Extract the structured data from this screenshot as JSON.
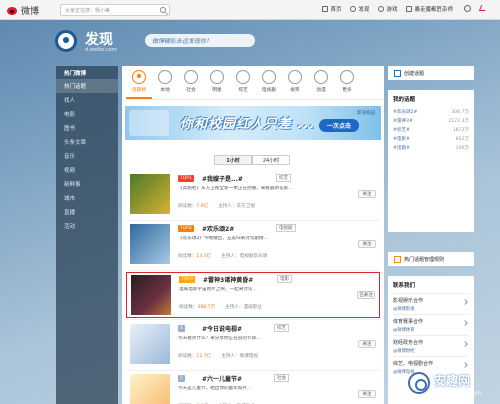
{
  "topbar": {
    "logo_text": "微博",
    "search_placeholder": "大家正在搜：杨小美",
    "nav": [
      "首页",
      "发现",
      "游戏",
      "暴走魔都匠杂师"
    ]
  },
  "header": {
    "title": "发现",
    "domain": "d.weibo.com",
    "slogan": "微博精彩永远发现你！"
  },
  "left_nav": {
    "items": [
      {
        "label": "热门微博",
        "head": true,
        "active": false
      },
      {
        "label": "热门话题",
        "head": false,
        "active": true
      },
      {
        "label": "找人",
        "head": false,
        "active": false
      },
      {
        "label": "电影",
        "head": false,
        "active": false
      },
      {
        "label": "图书",
        "head": false,
        "active": false
      },
      {
        "label": "头条文章",
        "head": false,
        "active": false
      },
      {
        "label": "音乐",
        "head": false,
        "active": false
      },
      {
        "label": "视频",
        "head": false,
        "active": false
      },
      {
        "label": "新鲜事",
        "head": false,
        "active": false
      },
      {
        "label": "城市",
        "head": false,
        "active": false
      },
      {
        "label": "直播",
        "head": false,
        "active": false
      },
      {
        "label": "活动",
        "head": false,
        "active": false
      }
    ]
  },
  "categories": [
    {
      "label": "话题榜",
      "active": true
    },
    {
      "label": "本地",
      "active": false
    },
    {
      "label": "社会",
      "active": false
    },
    {
      "label": "明星",
      "active": false
    },
    {
      "label": "综艺",
      "active": false
    },
    {
      "label": "电视剧",
      "active": false
    },
    {
      "label": "搞笑",
      "active": false
    },
    {
      "label": "动漫",
      "active": false
    },
    {
      "label": "更多",
      "active": false
    }
  ],
  "banner": {
    "text": "你和校园红人只差 ...",
    "button": "一次点击",
    "brand": "新浪校园"
  },
  "tabs": [
    "1小时",
    "24小时"
  ],
  "topics": [
    {
      "rank": "TOP1",
      "title": "#我嫂子是...#",
      "tag": "综艺",
      "desc": "《奔跑吧》东方卫视全新一季正在热播，来看最新花絮...",
      "stats_label": "阅读数：",
      "reads": "7.9亿",
      "host": "主持人：东方卫视",
      "follow": "关注",
      "thumb": "t1",
      "highlight": false
    },
    {
      "rank": "TOP2",
      "title": "#欢乐颂2#",
      "tag": "电视剧",
      "desc": "《欢乐颂2》今晚播出，五美归来讨论剧情...",
      "stats_label": "阅读数：",
      "reads": "13.3亿",
      "host": "主持人：电视剧欢乐颂",
      "follow": "关注",
      "thumb": "t2",
      "highlight": false
    },
    {
      "rank": "TOP3",
      "title": "#雷神3诸神黄昏#",
      "tag": "电影",
      "desc": "漫威电影宇宙新片上映，一起来讨论...",
      "stats_label": "阅读数：",
      "reads": "388.7万",
      "host": "主持人：漫威影业",
      "follow": "已关注",
      "thumb": "t3",
      "highlight": true
    },
    {
      "rank": "4",
      "title": "#今日说电视#",
      "tag": "综艺",
      "desc": "今天看点什么？来分享你正在追的节目...",
      "stats_label": "阅读数：",
      "reads": "12.7亿",
      "host": "主持人：微博电视",
      "follow": "关注",
      "thumb": "t4",
      "highlight": false
    },
    {
      "rank": "5",
      "title": "#六一儿童节#",
      "tag": "社会",
      "desc": "今天是儿童节，晒出你的童年照片...",
      "stats_label": "阅读数：",
      "reads": "6.8亿",
      "host": "主持人：微博社会",
      "follow": "关注",
      "thumb": "t5",
      "highlight": false
    }
  ],
  "right": {
    "create_topic": "创建话题",
    "my_topics_title": "我的话题",
    "my_topics": [
      {
        "name": "#欢乐颂2#",
        "count": "306.7万"
      },
      {
        "name": "#雷神3#",
        "count": "2122.3万"
      },
      {
        "name": "#综艺#",
        "count": "1872万"
      },
      {
        "name": "#电影#",
        "count": "852万"
      },
      {
        "name": "#话题#",
        "count": "100万"
      }
    ],
    "hot_help": "热门话题管理规则",
    "contact_title": "联系我们",
    "contacts": [
      {
        "key": "影视娱乐合作",
        "val": "@微博影视"
      },
      {
        "key": "体育赛事合作",
        "val": "@微博体育"
      },
      {
        "key": "财经政务合作",
        "val": "@微博财经"
      },
      {
        "key": "综艺、电视剧合作",
        "val": "@微博电视"
      }
    ]
  },
  "watermark": {
    "text": "安趣网",
    "url": "www.anqu.com"
  }
}
